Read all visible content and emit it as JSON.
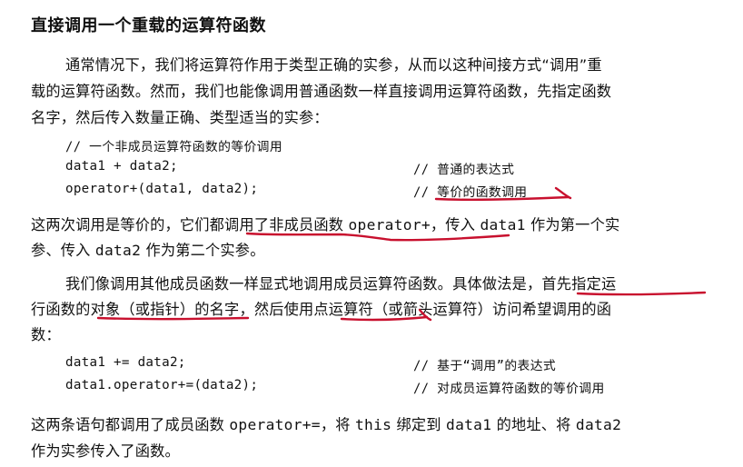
{
  "section": {
    "heading": "直接调用一个重载的运算符函数"
  },
  "para1": {
    "line1": "通常情况下，我们将运算符作用于类型正确的实参，从而以这种间接方式“调用”重",
    "line2": "载的运算符函数。然而，我们也能像调用普通函数一样直接调用运算符函数，先指定函数",
    "line3": "名字，然后传入数量正确、类型适当的实参："
  },
  "code1": {
    "comment": "// 一个非成员运算符函数的等价调用",
    "row1_code": "data1 + data2;",
    "row1_comment": "// 普通的表达式",
    "row2_code": "operator+(data1, data2);",
    "row2_comment_prefix": "// ",
    "row2_comment_marked": "等价的函数调用"
  },
  "para2": {
    "line1_a": "这两次调用是等价的，它们都",
    "line1_b": "调用了非成员函数 ",
    "line1_code": "operator+",
    "line1_c": "，传入 ",
    "line1_code2": "data1",
    "line1_d": " 作为第一个实",
    "line2_a": "参、传入 ",
    "line2_code": "data2",
    "line2_b": " 作为第二个实参。"
  },
  "para3": {
    "line1_a": "我们像调用其他成员函数一样显式地调用成员运算符函数。具体做法是，",
    "line1_b": "首先指定运",
    "line2_a": "行函数的",
    "line2_b": "对象（或指针）的名字",
    "line2_c": "，然后使用",
    "line2_d": "点运算符",
    "line2_e": "（或箭头运算符）访问希望调用的函",
    "line3": "数："
  },
  "code2": {
    "row1_code": "data1 += data2;",
    "row1_comment": "// 基于“调用”的表达式",
    "row2_code": "data1.operator+=(data2);",
    "row2_comment": "// 对成员运算符函数的等价调用"
  },
  "para4": {
    "line1_a": "这两条语句都调用了成员函数 ",
    "line1_code": "operator+=",
    "line1_b": "，将 ",
    "line1_code2": "this",
    "line1_c": " 绑定到 ",
    "line1_code3": "data1",
    "line1_d": " 的地址、将 ",
    "line1_code4": "data2",
    "line2": "作为实参传入了函数。"
  },
  "annotations": {
    "pen_color": "#c8102e"
  }
}
